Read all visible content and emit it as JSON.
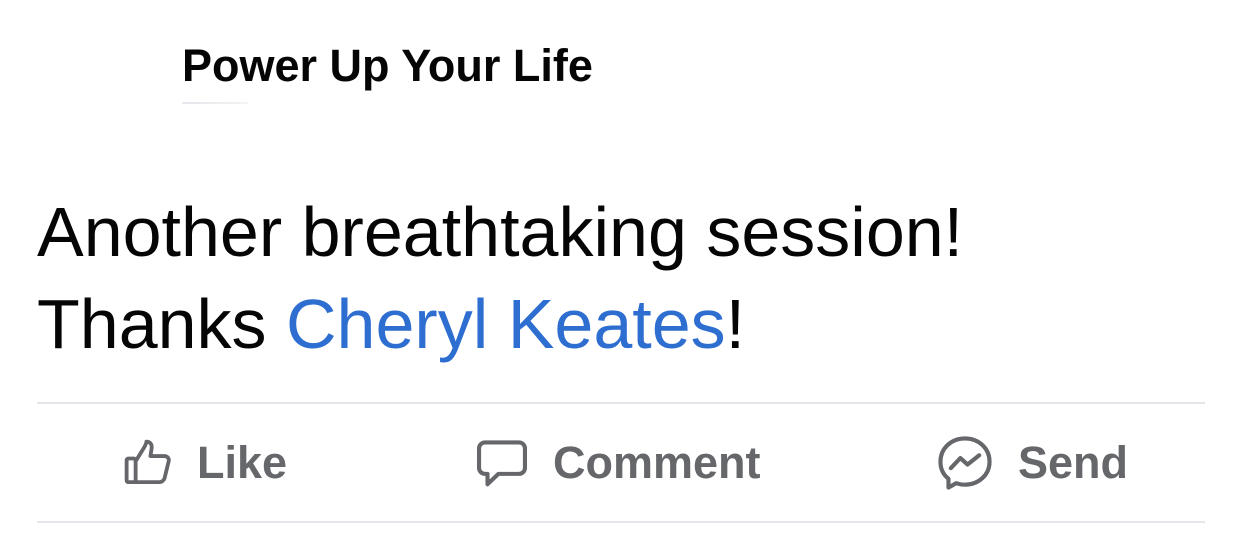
{
  "post": {
    "page_name": "Power Up Your Life",
    "body": {
      "line1": "Another breathtaking session!",
      "line2_prefix": "Thanks ",
      "mention": "Cheryl Keates",
      "line2_suffix": "!"
    }
  },
  "actions": {
    "like_label": "Like",
    "comment_label": "Comment",
    "send_label": "Send"
  },
  "icons": {
    "like": "thumbs-up-icon",
    "comment": "speech-bubble-icon",
    "send": "messenger-icon"
  },
  "colors": {
    "text": "#050505",
    "mention": "#2d6ed0",
    "action": "#65676b",
    "divider": "#e4e6eb"
  }
}
